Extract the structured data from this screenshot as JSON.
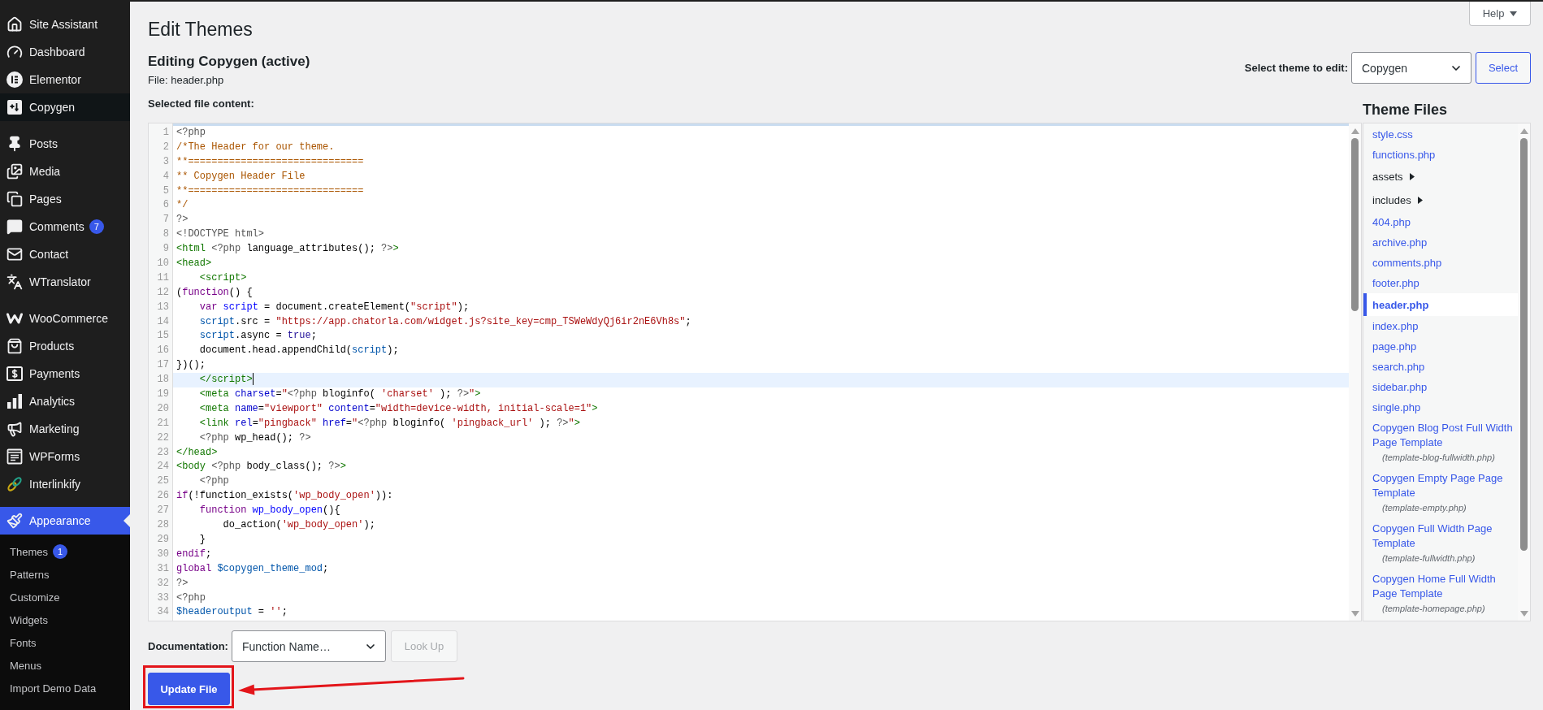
{
  "sidebar": {
    "groups": [
      {
        "items": [
          {
            "label": "Site Assistant",
            "selected": false,
            "highlighted": false
          },
          {
            "label": "Dashboard",
            "selected": false,
            "highlighted": false
          },
          {
            "label": "Elementor",
            "selected": false,
            "highlighted": false
          },
          {
            "label": "Copygen",
            "selected": false,
            "highlighted": true
          }
        ]
      },
      {
        "items": [
          {
            "label": "Posts",
            "selected": false,
            "highlighted": false
          },
          {
            "label": "Media",
            "selected": false,
            "highlighted": false
          },
          {
            "label": "Pages",
            "selected": false,
            "highlighted": false
          },
          {
            "label": "Comments",
            "selected": false,
            "highlighted": false,
            "badge": "7"
          },
          {
            "label": "Contact",
            "selected": false,
            "highlighted": false
          },
          {
            "label": "WTranslator",
            "selected": false,
            "highlighted": false
          }
        ]
      },
      {
        "items": [
          {
            "label": "WooCommerce",
            "selected": false,
            "highlighted": false
          },
          {
            "label": "Products",
            "selected": false,
            "highlighted": false
          },
          {
            "label": "Payments",
            "selected": false,
            "highlighted": false
          },
          {
            "label": "Analytics",
            "selected": false,
            "highlighted": false
          },
          {
            "label": "Marketing",
            "selected": false,
            "highlighted": false
          },
          {
            "label": "WPForms",
            "selected": false,
            "highlighted": false
          },
          {
            "label": "Interlinkify",
            "selected": false,
            "highlighted": false
          }
        ]
      },
      {
        "items": [
          {
            "label": "Appearance",
            "selected": true,
            "highlighted": false,
            "submenu": [
              {
                "label": "Themes",
                "badge": "1"
              },
              {
                "label": "Patterns"
              },
              {
                "label": "Customize"
              },
              {
                "label": "Widgets"
              },
              {
                "label": "Fonts"
              },
              {
                "label": "Menus"
              },
              {
                "label": "Import Demo Data"
              }
            ]
          }
        ]
      }
    ]
  },
  "help_button": {
    "label": "Help"
  },
  "page_title": "Edit Themes",
  "editing_title": "Editing Copygen (active)",
  "file_label": "File: header.php",
  "theme_picker": {
    "label": "Select theme to edit:",
    "value": "Copygen",
    "button": {
      "label": "Select"
    }
  },
  "editor": {
    "label": "Selected file content:",
    "lines": [
      {
        "number": "1",
        "active": false,
        "tokens": [
          {
            "kind": "meta",
            "text": "<?php"
          }
        ]
      },
      {
        "number": "2",
        "active": false,
        "tokens": [
          {
            "kind": "comment",
            "text": "/*The Header for our theme."
          }
        ]
      },
      {
        "number": "3",
        "active": false,
        "tokens": [
          {
            "kind": "comment",
            "text": "**=============================="
          }
        ]
      },
      {
        "number": "4",
        "active": false,
        "tokens": [
          {
            "kind": "comment",
            "text": "** Copygen Header File"
          }
        ]
      },
      {
        "number": "5",
        "active": false,
        "tokens": [
          {
            "kind": "comment",
            "text": "**=============================="
          }
        ]
      },
      {
        "number": "6",
        "active": false,
        "tokens": [
          {
            "kind": "comment",
            "text": "*/"
          }
        ]
      },
      {
        "number": "7",
        "active": false,
        "tokens": [
          {
            "kind": "meta",
            "text": "?>"
          }
        ]
      },
      {
        "number": "8",
        "active": false,
        "tokens": [
          {
            "kind": "meta",
            "text": "<!DOCTYPE html>"
          }
        ]
      },
      {
        "number": "9",
        "active": false,
        "tokens": [
          {
            "kind": "tag",
            "text": "<html"
          },
          {
            "kind": "meta",
            "text": " <?php"
          },
          {
            "kind": "plain",
            "text": " language_attributes(); "
          },
          {
            "kind": "meta",
            "text": "?>"
          },
          {
            "kind": "tag",
            "text": ">"
          }
        ]
      },
      {
        "number": "10",
        "active": false,
        "tokens": [
          {
            "kind": "tag",
            "text": "<head>"
          }
        ]
      },
      {
        "number": "11",
        "active": false,
        "tokens": [
          {
            "kind": "tag",
            "text": "    <script>"
          }
        ]
      },
      {
        "number": "12",
        "active": false,
        "tokens": [
          {
            "kind": "plain",
            "text": "("
          },
          {
            "kind": "keyword",
            "text": "function"
          },
          {
            "kind": "plain",
            "text": "() {"
          }
        ]
      },
      {
        "number": "13",
        "active": false,
        "tokens": [
          {
            "kind": "keyword",
            "text": "    var"
          },
          {
            "kind": "def",
            "text": " script"
          },
          {
            "kind": "plain",
            "text": " = document.createElement("
          },
          {
            "kind": "string",
            "text": "\"script\""
          },
          {
            "kind": "plain",
            "text": ");"
          }
        ]
      },
      {
        "number": "14",
        "active": false,
        "tokens": [
          {
            "kind": "variable",
            "text": "    script"
          },
          {
            "kind": "plain",
            "text": ".src = "
          },
          {
            "kind": "string",
            "text": "\"https://app.chatorla.com/widget.js?site_key=cmp_TSWeWdyQj6ir2nE6Vh8s\""
          },
          {
            "kind": "plain",
            "text": ";"
          }
        ]
      },
      {
        "number": "15",
        "active": false,
        "tokens": [
          {
            "kind": "variable",
            "text": "    script"
          },
          {
            "kind": "plain",
            "text": ".async = "
          },
          {
            "kind": "atom",
            "text": "true"
          },
          {
            "kind": "plain",
            "text": ";"
          }
        ]
      },
      {
        "number": "16",
        "active": false,
        "tokens": [
          {
            "kind": "plain",
            "text": "    document.head.appendChild("
          },
          {
            "kind": "variable",
            "text": "script"
          },
          {
            "kind": "plain",
            "text": ");"
          }
        ]
      },
      {
        "number": "17",
        "active": false,
        "tokens": [
          {
            "kind": "plain",
            "text": "})();"
          }
        ]
      },
      {
        "number": "18",
        "active": true,
        "tokens": [
          {
            "kind": "tag",
            "text": "    </script>"
          }
        ]
      },
      {
        "number": "19",
        "active": false,
        "tokens": [
          {
            "kind": "tag",
            "text": "    <meta"
          },
          {
            "kind": "attribute",
            "text": " charset"
          },
          {
            "kind": "plain",
            "text": "="
          },
          {
            "kind": "string",
            "text": "\""
          },
          {
            "kind": "meta",
            "text": "<?php"
          },
          {
            "kind": "plain",
            "text": " bloginfo( "
          },
          {
            "kind": "string",
            "text": "'charset'"
          },
          {
            "kind": "plain",
            "text": " ); "
          },
          {
            "kind": "meta",
            "text": "?>"
          },
          {
            "kind": "string",
            "text": "\""
          },
          {
            "kind": "tag",
            "text": ">"
          }
        ]
      },
      {
        "number": "20",
        "active": false,
        "tokens": [
          {
            "kind": "tag",
            "text": "    <meta"
          },
          {
            "kind": "attribute",
            "text": " name"
          },
          {
            "kind": "plain",
            "text": "="
          },
          {
            "kind": "string",
            "text": "\"viewport\""
          },
          {
            "kind": "attribute",
            "text": " content"
          },
          {
            "kind": "plain",
            "text": "="
          },
          {
            "kind": "string",
            "text": "\"width=device-width, initial-scale=1\""
          },
          {
            "kind": "tag",
            "text": ">"
          }
        ]
      },
      {
        "number": "21",
        "active": false,
        "tokens": [
          {
            "kind": "tag",
            "text": "    <link"
          },
          {
            "kind": "attribute",
            "text": " rel"
          },
          {
            "kind": "plain",
            "text": "="
          },
          {
            "kind": "string",
            "text": "\"pingback\""
          },
          {
            "kind": "attribute",
            "text": " href"
          },
          {
            "kind": "plain",
            "text": "="
          },
          {
            "kind": "string",
            "text": "\""
          },
          {
            "kind": "meta",
            "text": "<?php"
          },
          {
            "kind": "plain",
            "text": " bloginfo( "
          },
          {
            "kind": "string",
            "text": "'pingback_url'"
          },
          {
            "kind": "plain",
            "text": " ); "
          },
          {
            "kind": "meta",
            "text": "?>"
          },
          {
            "kind": "string",
            "text": "\""
          },
          {
            "kind": "tag",
            "text": ">"
          }
        ]
      },
      {
        "number": "22",
        "active": false,
        "tokens": [
          {
            "kind": "meta",
            "text": "    <?php"
          },
          {
            "kind": "plain",
            "text": " wp_head(); "
          },
          {
            "kind": "meta",
            "text": "?>"
          }
        ]
      },
      {
        "number": "23",
        "active": false,
        "tokens": [
          {
            "kind": "tag",
            "text": "</head>"
          }
        ]
      },
      {
        "number": "24",
        "active": false,
        "tokens": [
          {
            "kind": "tag",
            "text": "<body"
          },
          {
            "kind": "meta",
            "text": " <?php"
          },
          {
            "kind": "plain",
            "text": " body_class(); "
          },
          {
            "kind": "meta",
            "text": "?>"
          },
          {
            "kind": "tag",
            "text": ">"
          }
        ]
      },
      {
        "number": "25",
        "active": false,
        "tokens": [
          {
            "kind": "meta",
            "text": "    <?php"
          }
        ]
      },
      {
        "number": "26",
        "active": false,
        "tokens": [
          {
            "kind": "keyword",
            "text": "if"
          },
          {
            "kind": "plain",
            "text": "(!function_exists("
          },
          {
            "kind": "string",
            "text": "'wp_body_open'"
          },
          {
            "kind": "plain",
            "text": ")):"
          }
        ]
      },
      {
        "number": "27",
        "active": false,
        "tokens": [
          {
            "kind": "keyword",
            "text": "    function"
          },
          {
            "kind": "def",
            "text": " wp_body_open"
          },
          {
            "kind": "plain",
            "text": "(){"
          }
        ]
      },
      {
        "number": "28",
        "active": false,
        "tokens": [
          {
            "kind": "plain",
            "text": "        do_action("
          },
          {
            "kind": "string",
            "text": "'wp_body_open'"
          },
          {
            "kind": "plain",
            "text": ");"
          }
        ]
      },
      {
        "number": "29",
        "active": false,
        "tokens": [
          {
            "kind": "plain",
            "text": "    }"
          }
        ]
      },
      {
        "number": "30",
        "active": false,
        "tokens": [
          {
            "kind": "keyword",
            "text": "endif"
          },
          {
            "kind": "plain",
            "text": ";"
          }
        ]
      },
      {
        "number": "31",
        "active": false,
        "tokens": [
          {
            "kind": "keyword",
            "text": "global"
          },
          {
            "kind": "variable",
            "text": " $copygen_theme_mod"
          },
          {
            "kind": "plain",
            "text": ";"
          }
        ]
      },
      {
        "number": "32",
        "active": false,
        "tokens": [
          {
            "kind": "meta",
            "text": "?>"
          }
        ]
      },
      {
        "number": "33",
        "active": false,
        "tokens": [
          {
            "kind": "meta",
            "text": "<?php"
          }
        ]
      },
      {
        "number": "34",
        "active": false,
        "tokens": [
          {
            "kind": "variable",
            "text": "$headeroutput"
          },
          {
            "kind": "plain",
            "text": " = "
          },
          {
            "kind": "string",
            "text": "''"
          },
          {
            "kind": "plain",
            "text": ";"
          }
        ]
      }
    ]
  },
  "theme_files": {
    "title": "Theme Files",
    "items": [
      {
        "kind": "file",
        "name": "style.css",
        "selected": false
      },
      {
        "kind": "file",
        "name": "functions.php",
        "selected": false
      },
      {
        "kind": "folder",
        "name": "assets",
        "expanded": false,
        "selected": false
      },
      {
        "kind": "folder",
        "name": "includes",
        "expanded": false,
        "selected": false
      },
      {
        "kind": "file",
        "name": "404.php",
        "selected": false
      },
      {
        "kind": "file",
        "name": "archive.php",
        "selected": false
      },
      {
        "kind": "file",
        "name": "comments.php",
        "selected": false
      },
      {
        "kind": "file",
        "name": "footer.php",
        "selected": false
      },
      {
        "kind": "file",
        "name": "header.php",
        "selected": true
      },
      {
        "kind": "file",
        "name": "index.php",
        "selected": false
      },
      {
        "kind": "file",
        "name": "page.php",
        "selected": false
      },
      {
        "kind": "file",
        "name": "search.php",
        "selected": false
      },
      {
        "kind": "file",
        "name": "sidebar.php",
        "selected": false
      },
      {
        "kind": "file",
        "name": "single.php",
        "selected": false
      },
      {
        "kind": "template",
        "name": "Copygen Blog Post Full Width Page Template",
        "filename": "(template-blog-fullwidth.php)",
        "selected": false
      },
      {
        "kind": "template",
        "name": "Copygen Empty Page Page Template",
        "filename": "(template-empty.php)",
        "selected": false
      },
      {
        "kind": "template",
        "name": "Copygen Full Width Page Template",
        "filename": "(template-fullwidth.php)",
        "selected": false
      },
      {
        "kind": "template",
        "name": "Copygen Home Full Width Page Template",
        "filename": "(template-homepage.php)",
        "selected": false
      }
    ]
  },
  "documentation": {
    "label": "Documentation:",
    "value": "Function Name…",
    "button": {
      "label": "Look Up",
      "disabled": true
    }
  },
  "update_button": {
    "label": "Update File"
  },
  "annotations": [
    {
      "kind": "outline"
    },
    {
      "kind": "arrow"
    }
  ]
}
